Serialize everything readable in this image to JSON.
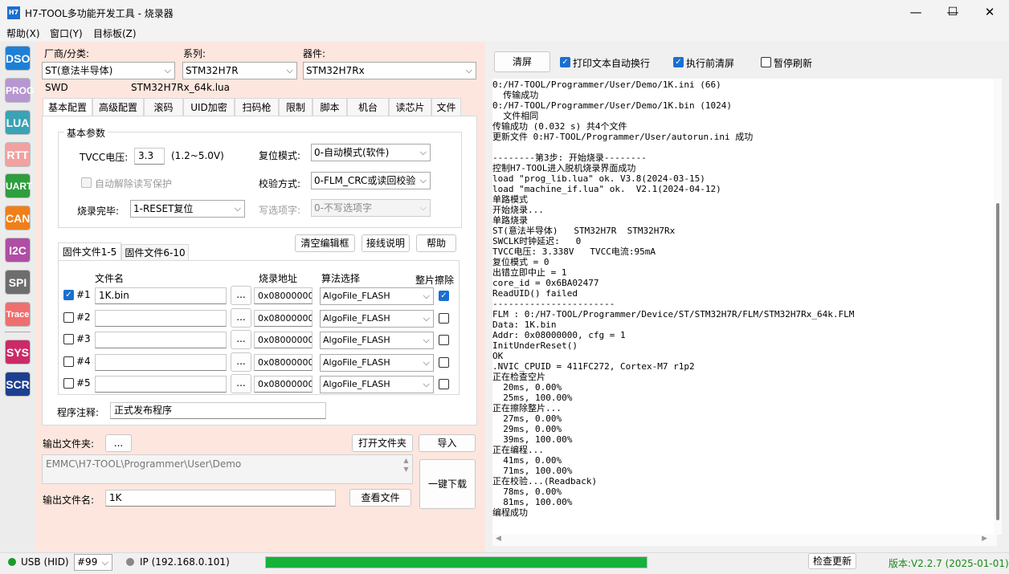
{
  "window": {
    "icon_text": "H7",
    "title": "H7-TOOL多功能开发工具 - 烧录器",
    "minimize": "—",
    "maximize": "☐",
    "close": "✕"
  },
  "menu": [
    "帮助(X)",
    "窗口(Y)",
    "目标板(Z)"
  ],
  "sidebar": [
    {
      "label": "DSO",
      "color": "#1e7fd6"
    },
    {
      "label": "PROG",
      "color": "#b797d2"
    },
    {
      "label": "LUA",
      "color": "#3aa3b6"
    },
    {
      "label": "RTT",
      "color": "#f2a1a1"
    },
    {
      "label": "UART",
      "color": "#2e9e3e"
    },
    {
      "label": "CAN",
      "color": "#ef7f1a"
    },
    {
      "label": "I2C",
      "color": "#b04ea5"
    },
    {
      "label": "SPI",
      "color": "#6d6d6d"
    },
    {
      "label": "Trace",
      "color": "#ef6f6f"
    },
    {
      "label": "SYS",
      "color": "#cc2a66"
    },
    {
      "label": "SCR",
      "color": "#1c3f8f"
    }
  ],
  "device": {
    "vendor_label": "厂商/分类:",
    "vendor_value": "ST(意法半导体)",
    "series_label": "系列:",
    "series_value": "STM32H7R",
    "part_label": "器件:",
    "part_value": "STM32H7Rx",
    "interface": "SWD",
    "lua_file": "STM32H7Rx_64k.lua"
  },
  "tabs": [
    "基本配置",
    "高级配置",
    "滚码",
    "UID加密",
    "扫码枪",
    "限制",
    "脚本",
    "机台",
    "读芯片",
    "文件"
  ],
  "basic": {
    "group_title": "基本参数",
    "tvcc_label": "TVCC电压:",
    "tvcc_value": "3.3",
    "tvcc_range": "(1.2~5.0V)",
    "auto_unlock": "自动解除读写保护",
    "finish_label": "烧录完毕:",
    "finish_value": "1-RESET复位",
    "reset_label": "复位模式:",
    "reset_value": "0-自动模式(软件)",
    "verify_label": "校验方式:",
    "verify_value": "0-FLM_CRC或读回校验",
    "option_label": "写选项字:",
    "option_value": "0-不写选项字"
  },
  "file_tabs": [
    "固件文件1-5",
    "固件文件6-10"
  ],
  "buttons": {
    "clear_box": "清空编辑框",
    "wiring": "接线说明",
    "help": "帮助"
  },
  "file_headers": {
    "name": "文件名",
    "addr": "烧录地址",
    "algo": "算法选择",
    "erase": "整片擦除"
  },
  "files": [
    {
      "idx": "#1",
      "checked": true,
      "name": "1K.bin",
      "addr": "0x08000000",
      "algo": "AlgoFile_FLASH",
      "erase": true
    },
    {
      "idx": "#2",
      "checked": false,
      "name": "",
      "addr": "0x08000000",
      "algo": "AlgoFile_FLASH",
      "erase": false
    },
    {
      "idx": "#3",
      "checked": false,
      "name": "",
      "addr": "0x08000000",
      "algo": "AlgoFile_FLASH",
      "erase": false
    },
    {
      "idx": "#4",
      "checked": false,
      "name": "",
      "addr": "0x08000000",
      "algo": "AlgoFile_FLASH",
      "erase": false
    },
    {
      "idx": "#5",
      "checked": false,
      "name": "",
      "addr": "0x08000000",
      "algo": "AlgoFile_FLASH",
      "erase": false
    }
  ],
  "browse": "...",
  "note_label": "程序注释:",
  "note_value": "正式发布程序",
  "output": {
    "folder_label": "输出文件夹:",
    "folder_browse": "...",
    "open_folder": "打开文件夹",
    "import": "导入",
    "path": "EMMC\\H7-TOOL\\Programmer\\User\\Demo",
    "one_click": "一键下载",
    "file_label": "输出文件名:",
    "file_value": "1K",
    "view_file": "查看文件"
  },
  "right": {
    "clear": "清屏",
    "wrap": "打印文本自动换行",
    "clear_before": "执行前清屏",
    "pause": "暂停刷新"
  },
  "log": [
    "0:/H7-TOOL/Programmer/User/Demo/1K.ini (66)",
    "  传输成功",
    "0:/H7-TOOL/Programmer/User/Demo/1K.bin (1024)",
    "  文件相同",
    "传输成功 (0.032 s) 共4个文件",
    "更新文件 0:H7-TOOL/Programmer/User/autorun.ini 成功",
    "",
    "--------第3步: 开始烧录--------",
    "控制H7-TOOL进入脱机烧录界面成功",
    "load \"prog_lib.lua\" ok. V3.8(2024-03-15)",
    "load \"machine_if.lua\" ok.  V2.1(2024-04-12)",
    "单路模式",
    "开始烧录...",
    "单路烧录",
    "ST(意法半导体)   STM32H7R  STM32H7Rx",
    "SWCLK时钟延迟:   0",
    "TVCC电压: 3.338V   TVCC电流:95mA",
    "复位模式 = 0",
    "出错立即中止 = 1",
    "core_id = 0x6BA02477",
    "ReadUID() failed",
    "-----------------------",
    "FLM : 0:/H7-TOOL/Programmer/Device/ST/STM32H7R/FLM/STM32H7Rx_64k.FLM",
    "Data: 1K.bin",
    "Addr: 0x08000000, cfg = 1",
    "InitUnderReset()",
    "OK",
    ".NVIC_CPUID = 411FC272, Cortex-M7 r1p2",
    "正在检查空片",
    "  20ms, 0.00%",
    "  25ms, 100.00%",
    "正在擦除整片...",
    "  27ms, 0.00%",
    "  29ms, 0.00%",
    "  39ms, 100.00%",
    "正在编程...",
    "  41ms, 0.00%",
    "  71ms, 100.00%",
    "正在校验...(Readback)",
    "  78ms, 0.00%",
    "  81ms, 100.00%",
    "编程成功"
  ],
  "status": {
    "usb": "USB (HID)",
    "usb_color": "#1a9a2a",
    "device_no": "#99",
    "ip": "IP (192.168.0.101)",
    "ip_color": "#888888",
    "progress": 1.0,
    "progress_color": "#16b23a",
    "check_update": "检查更新",
    "version": "版本:V2.2.7 (2025-01-01)",
    "version_color": "#1a8a1a"
  }
}
